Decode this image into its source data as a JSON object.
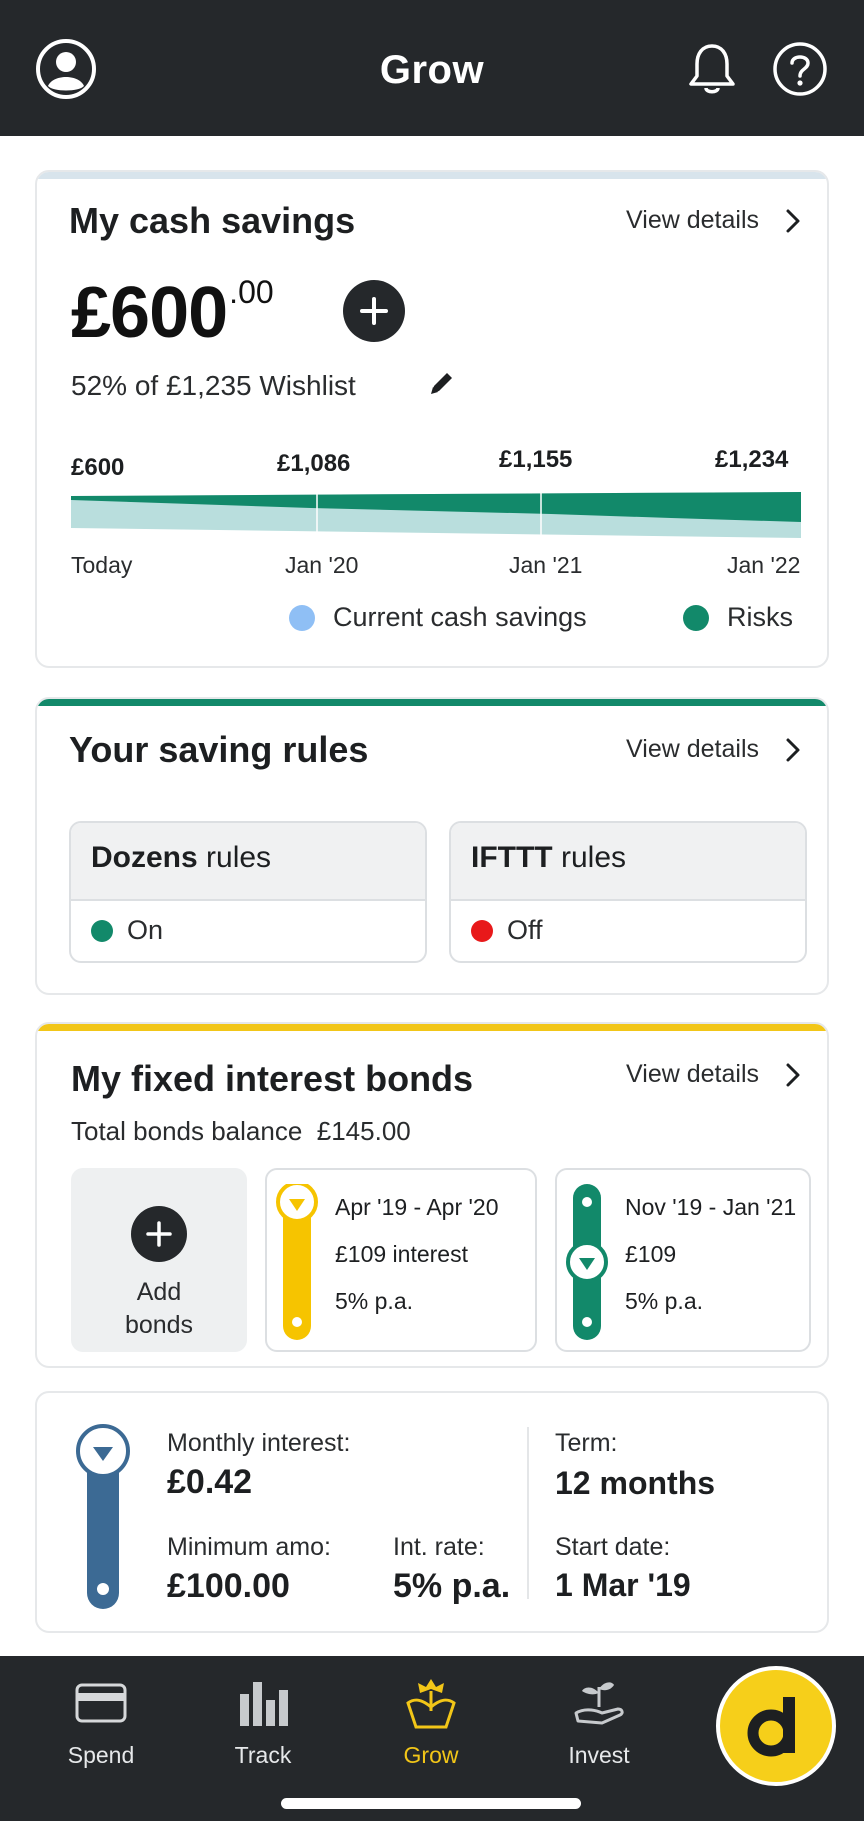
{
  "header": {
    "title": "Grow",
    "icons": [
      "profile-icon",
      "bell-icon",
      "help-icon"
    ]
  },
  "cash_savings": {
    "title": "My cash savings",
    "view_details": "View details",
    "amount_main": "£600",
    "amount_decimal": ".00",
    "wishlist_text": "52% of £1,235 Wishlist",
    "projection": {
      "values": [
        "£600",
        "£1,086",
        "£1,155",
        "£1,234"
      ],
      "dates": [
        "Today",
        "Jan '20",
        "Jan '21",
        "Jan '22"
      ]
    },
    "legend": [
      {
        "label": "Current cash savings",
        "color": "#8fbff5"
      },
      {
        "label": "Risks",
        "color": "#12896a"
      }
    ]
  },
  "saving_rules": {
    "title": "Your saving rules",
    "view_details": "View details",
    "rules": [
      {
        "name": "Dozens",
        "suffix": " rules",
        "status": "On",
        "status_color": "#12896a"
      },
      {
        "name": "IFTTT",
        "suffix": " rules",
        "status": "Off",
        "status_color": "#e8191a"
      }
    ]
  },
  "bonds": {
    "title": "My fixed interest bonds",
    "view_details": "View details",
    "balance_label": "Total bonds balance",
    "balance_value": "£145.00",
    "add_label_1": "Add",
    "add_label_2": "bonds",
    "items": [
      {
        "period": "Apr '19 - Apr '20",
        "amount": "£109 interest",
        "rate": "5% p.a.",
        "color": "#f6c400"
      },
      {
        "period": "Nov '19 - Jan '21",
        "amount": "£109",
        "rate": "5% p.a.",
        "color": "#12896a"
      }
    ]
  },
  "bond_detail": {
    "monthly_interest_label": "Monthly interest:",
    "monthly_interest_value": "£0.42",
    "minimum_label": "Minimum amo:",
    "minimum_value": "£100.00",
    "rate_label": "Int. rate:",
    "rate_value": "5% p.a.",
    "term_label": "Term:",
    "term_value": "12 months",
    "start_label": "Start date:",
    "start_value": "1 Mar '19",
    "color": "#3c6a94"
  },
  "bottom_nav": {
    "items": [
      {
        "label": "Spend",
        "icon": "card-icon"
      },
      {
        "label": "Track",
        "icon": "bar-chart-icon"
      },
      {
        "label": "Grow",
        "icon": "plant-icon",
        "active": true
      },
      {
        "label": "Invest",
        "icon": "sprout-hand-icon"
      }
    ],
    "logo_letter": "d"
  },
  "colors": {
    "dark": "#25282b",
    "accent_yellow": "#f2c618",
    "accent_green": "#12896a"
  }
}
